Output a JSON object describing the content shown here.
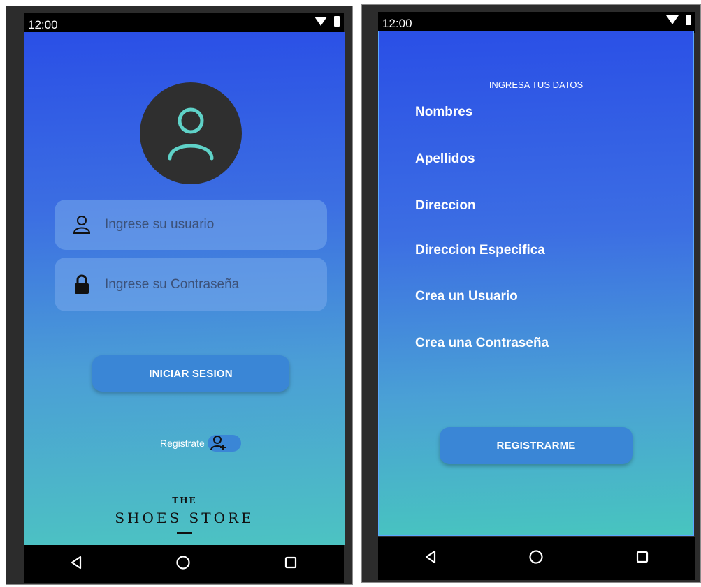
{
  "status_bar": {
    "time": "12:00"
  },
  "login": {
    "username_placeholder": "Ingrese su usuario",
    "password_placeholder": "Ingrese su Contraseña",
    "login_button": "INICIAR SESION",
    "register_link": "Registrate",
    "logo": {
      "line1": "THE",
      "line2": "SHOES STORE"
    }
  },
  "register": {
    "title": "INGRESA TUS DATOS",
    "fields": [
      "Nombres",
      "Apellidos",
      "Direccion",
      "Direccion Especifica",
      "Crea un Usuario",
      "Crea una Contraseña"
    ],
    "submit_button": "REGISTRARME"
  },
  "colors": {
    "gradient_top": "#2a4fe6",
    "gradient_bottom": "#4cc3c2",
    "button": "#3a86d6",
    "avatar_bg": "#2f2f2f",
    "avatar_icon": "#5fd2c8"
  }
}
